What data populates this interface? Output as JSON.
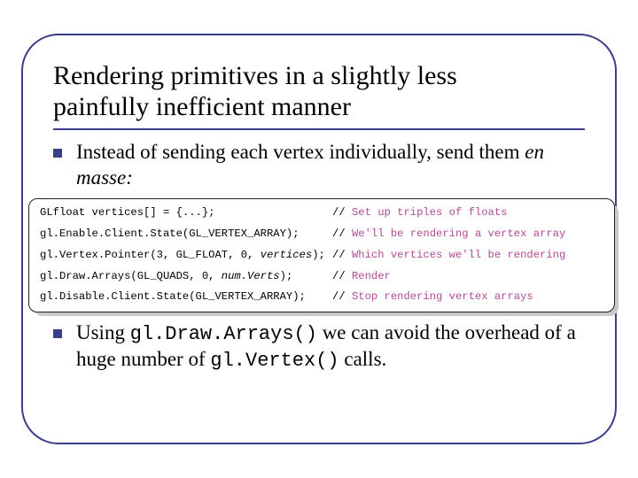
{
  "title_line1": "Rendering primitives in a slightly less",
  "title_line2": "painfully inefficient manner",
  "bullet1_pre": "Instead of sending each vertex individually, send them ",
  "bullet1_italic": "en masse:",
  "code": [
    {
      "left_pre": "GLfloat vertices[] = {...};",
      "left_arg": "",
      "left_post": "",
      "comment": "Set up triples of floats"
    },
    {
      "left_pre": "gl.Enable.Client.State(GL_VERTEX_ARRAY);",
      "left_arg": "",
      "left_post": "",
      "comment": "We'll be rendering a vertex array"
    },
    {
      "left_pre": "gl.Vertex.Pointer(3, GL_FLOAT, 0, ",
      "left_arg": "vertices",
      "left_post": ");",
      "comment": "Which vertices we'll be rendering"
    },
    {
      "left_pre": "gl.Draw.Arrays(GL_QUADS, 0, ",
      "left_arg": "num.Verts",
      "left_post": ");",
      "comment": "Render"
    },
    {
      "left_pre": "gl.Disable.Client.State(GL_VERTEX_ARRAY);",
      "left_arg": "",
      "left_post": "",
      "comment": "Stop rendering vertex arrays"
    }
  ],
  "bullet2_pre": "Using ",
  "bullet2_mono1": "gl.Draw.Arrays()",
  "bullet2_mid": " we can avoid the overhead of a huge number of ",
  "bullet2_mono2": "gl.Vertex()",
  "bullet2_post": " calls."
}
